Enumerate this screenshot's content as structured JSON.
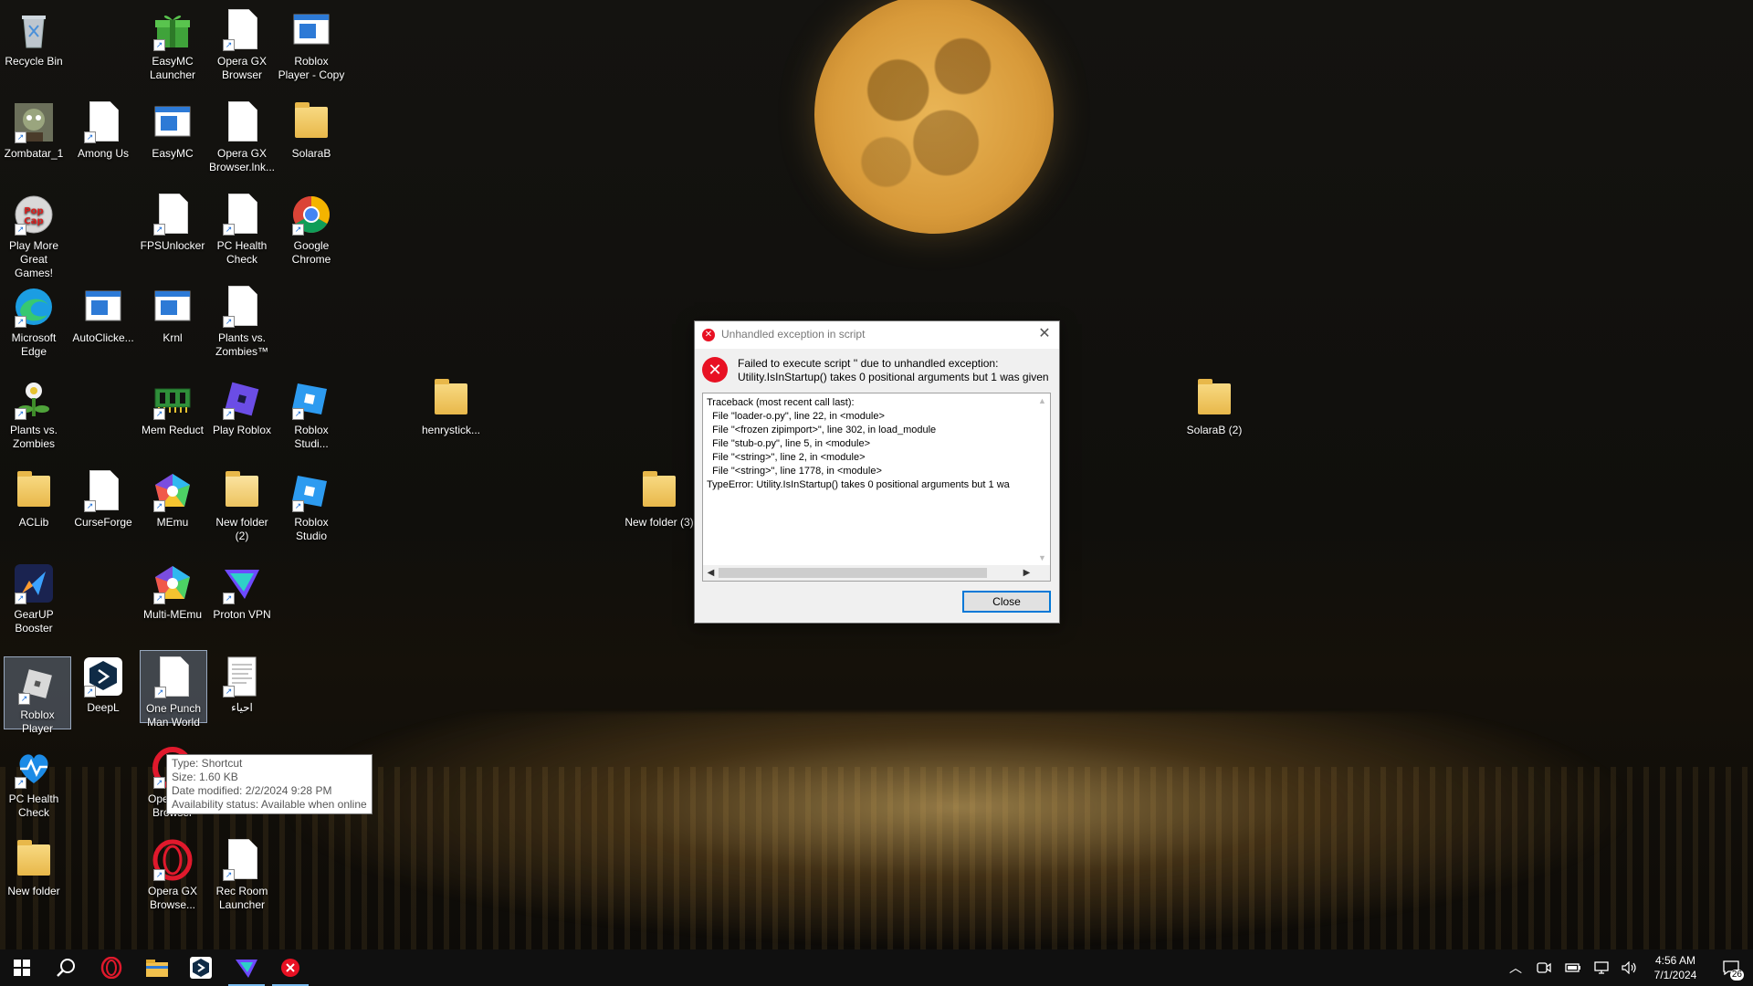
{
  "desktop": {
    "icons": [
      {
        "label": "Recycle Bin",
        "icon": "recycle-bin-icon"
      },
      {
        "label": "EasyMC Launcher",
        "icon": "gift-icon"
      },
      {
        "label": "Opera GX Browser",
        "icon": "file-icon"
      },
      {
        "label": "Roblox Player - Copy",
        "icon": "window-icon"
      },
      {
        "label": "Zombatar_1",
        "icon": "zombie-icon"
      },
      {
        "label": "Among Us",
        "icon": "file-icon"
      },
      {
        "label": "EasyMC",
        "icon": "window-icon"
      },
      {
        "label": "Opera GX Browser.lnk...",
        "icon": "file-icon"
      },
      {
        "label": "SolaraB",
        "icon": "folder-icon"
      },
      {
        "label": "Play More Great Games!",
        "icon": "popcap-icon"
      },
      {
        "label": "FPSUnlocker",
        "icon": "file-icon"
      },
      {
        "label": "PC Health Check",
        "icon": "file-icon"
      },
      {
        "label": "Google Chrome",
        "icon": "chrome-icon"
      },
      {
        "label": "Microsoft Edge",
        "icon": "edge-icon"
      },
      {
        "label": "AutoClicke...",
        "icon": "window-icon"
      },
      {
        "label": "Krnl",
        "icon": "window-icon"
      },
      {
        "label": "Plants vs. Zombies™",
        "icon": "file-icon"
      },
      {
        "label": "Plants vs. Zombies",
        "icon": "plant-icon"
      },
      {
        "label": "Mem Reduct",
        "icon": "memory-icon"
      },
      {
        "label": "Play Roblox",
        "icon": "roblox-icon"
      },
      {
        "label": "Roblox Studi...",
        "icon": "roblox-studio-icon"
      },
      {
        "label": "henrystick...",
        "icon": "folder-icon"
      },
      {
        "label": "SolaraB (2)",
        "icon": "folder-icon"
      },
      {
        "label": "ACLib",
        "icon": "folder-icon"
      },
      {
        "label": "CurseForge",
        "icon": "file-icon"
      },
      {
        "label": "MEmu",
        "icon": "memu-icon"
      },
      {
        "label": "New folder (2)",
        "icon": "folder-icon"
      },
      {
        "label": "Roblox Studio",
        "icon": "roblox-studio-icon"
      },
      {
        "label": "New folder (3)",
        "icon": "folder-icon"
      },
      {
        "label": "GearUP Booster",
        "icon": "gearup-icon"
      },
      {
        "label": "Multi-MEmu",
        "icon": "memu-icon"
      },
      {
        "label": "Proton VPN",
        "icon": "protonvpn-icon"
      },
      {
        "label": "Roblox Player",
        "icon": "roblox-icon"
      },
      {
        "label": "DeepL",
        "icon": "deepl-icon"
      },
      {
        "label": "One Punch Man World",
        "icon": "file-icon"
      },
      {
        "label": "احياء",
        "icon": "document-icon"
      },
      {
        "label": "PC Health Check",
        "icon": "health-icon"
      },
      {
        "label": "Opera GX Browser",
        "icon": "opera-icon"
      },
      {
        "label": "New folder",
        "icon": "folder-icon"
      },
      {
        "label": "Opera GX Browse...",
        "icon": "opera-icon"
      },
      {
        "label": "Rec Room Launcher",
        "icon": "file-icon"
      }
    ]
  },
  "tooltip": {
    "line1": "Type: Shortcut",
    "line2": "Size: 1.60 KB",
    "line3": "Date modified: 2/2/2024 9:28 PM",
    "line4": "Availability status: Available when online"
  },
  "dialog": {
    "title": "Unhandled exception in script",
    "message_line1": "Failed to execute script '' due to unhandled exception:",
    "message_line2": "Utility.IsInStartup() takes 0 positional arguments but 1 was given",
    "traceback": "Traceback (most recent call last):\n  File \"loader-o.py\", line 22, in <module>\n  File \"<frozen zipimport>\", line 302, in load_module\n  File \"stub-o.py\", line 5, in <module>\n  File \"<string>\", line 2, in <module>\n  File \"<string>\", line 1778, in <module>\nTypeError: Utility.IsInStartup() takes 0 positional arguments but 1 wa",
    "close_label": "Close"
  },
  "taskbar": {
    "time": "4:56 AM",
    "date": "7/1/2024",
    "notification_count": "26"
  },
  "colors": {
    "error_red": "#e81123",
    "accent_blue": "#0078d7",
    "taskbar_bg": "#101010"
  }
}
